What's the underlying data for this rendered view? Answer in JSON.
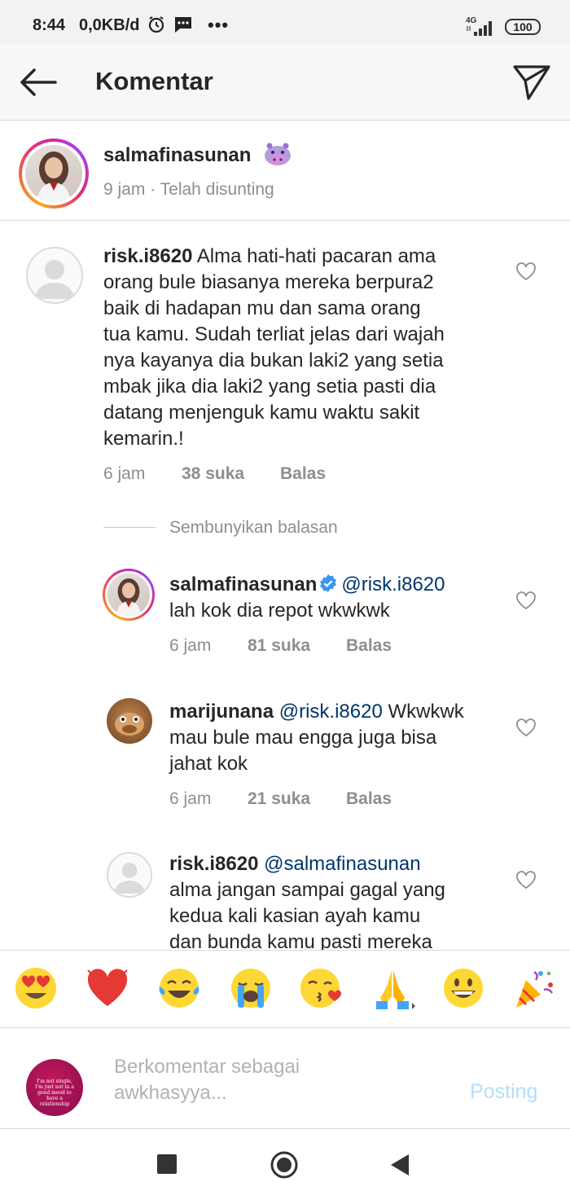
{
  "status_bar": {
    "time": "8:44",
    "net_speed": "0,0KB/d",
    "more": "•••",
    "network": "4G",
    "battery": "100"
  },
  "header": {
    "title": "Komentar",
    "icons": [
      "back-arrow-icon",
      "send-icon"
    ]
  },
  "caption": {
    "username": "salmafinasunan",
    "emoji": "hippo",
    "meta": "9 jam · Telah disunting"
  },
  "comments": [
    {
      "username": "risk.i8620",
      "lines": [
        "Alma hati-hati pacaran ama",
        "orang bule  biasanya mereka berpura2",
        "baik di hadapan mu  dan sama orang",
        "tua kamu. Sudah terliat jelas dari wajah",
        "nya  kayanya  dia bukan laki2 yang setia",
        "mbak jika dia laki2 yang setia pasti dia",
        "datang menjenguk kamu waktu sakit",
        "kemarin.!"
      ],
      "time": "6 jam",
      "likes": "38 suka",
      "reply": "Balas"
    }
  ],
  "hide_replies": "Sembunyikan balasan",
  "replies": [
    {
      "username": "salmafinasunan",
      "verified": true,
      "mention": "@risk.i8620",
      "line1_rest": "",
      "lines": [
        "lah kok dia repot wkwkwk"
      ],
      "time": "6 jam",
      "likes": "81 suka",
      "reply": "Balas"
    },
    {
      "username": "marijunana",
      "mention": "@risk.i8620",
      "line1_rest": "Wkwkwk",
      "lines": [
        "mau bule mau engga juga bisa",
        "jahat kok"
      ],
      "time": "6 jam",
      "likes": "21 suka",
      "reply": "Balas"
    },
    {
      "username": "risk.i8620",
      "mention": "@salmafinasunan",
      "line1_rest": "",
      "lines": [
        "alma jangan sampai gagal yang",
        "kedua kali kasian ayah kamu",
        "dan bunda kamu pasti mereka"
      ]
    }
  ],
  "emoji_bar": [
    "heart-eyes",
    "red-heart",
    "tears-of-joy",
    "loudly-crying",
    "face-blowing-kiss",
    "folded-hands",
    "grinning-face",
    "party-popper"
  ],
  "composer": {
    "avatar_text": "I'm not single, I'm just not in a good mood to have a relationship",
    "placeholder": "Berkomentar sebagai awkhasyya...",
    "placeholder_line1": "Berkomentar sebagai",
    "placeholder_line2": "awkhasyya...",
    "post_label": "Posting"
  },
  "nav": [
    "recent-apps-icon",
    "home-icon",
    "back-icon"
  ]
}
